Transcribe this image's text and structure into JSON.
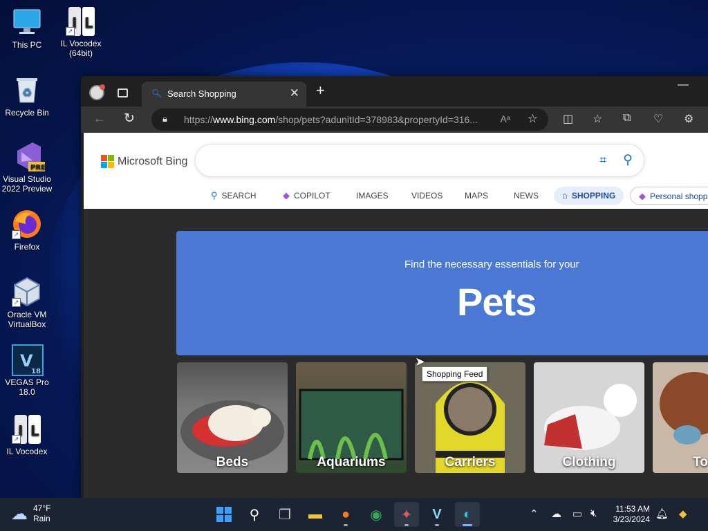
{
  "desktop": {
    "icons": [
      {
        "label": "This PC",
        "icon": "monitor-icon"
      },
      {
        "label": "IL Vocodex (64bit)",
        "icon": "il-vocodex-icon"
      },
      {
        "label": "Recycle Bin",
        "icon": "recycle-bin-icon"
      },
      {
        "label": "Visual Studio 2022 Preview",
        "icon": "visual-studio-icon"
      },
      {
        "label": "Firefox",
        "icon": "firefox-icon"
      },
      {
        "label": "Oracle VM VirtualBox",
        "icon": "virtualbox-icon"
      },
      {
        "label": "VEGAS Pro 18.0",
        "icon": "vegas-icon"
      },
      {
        "label": "IL Vocodex",
        "icon": "il-vocodex-icon"
      }
    ]
  },
  "browser": {
    "tab_title": "Search Shopping",
    "url_prefix": "https://",
    "url_host": "www.bing.com",
    "url_rest": "/shop/pets?adunitId=378983&propertyId=316...",
    "logo_text": "Microsoft Bing",
    "search_placeholder": "",
    "scopes": [
      {
        "label": "SEARCH",
        "icon": "search-icon"
      },
      {
        "label": "COPILOT",
        "icon": "copilot-icon"
      },
      {
        "label": "IMAGES"
      },
      {
        "label": "VIDEOS"
      },
      {
        "label": "MAPS"
      },
      {
        "label": "NEWS"
      },
      {
        "label": "SHOPPING",
        "icon": "shopping-icon",
        "active": true
      },
      {
        "label": "Personal shopp",
        "icon": "copilot-icon"
      }
    ],
    "hero": {
      "subtitle": "Find the necessary essentials for your",
      "title": "Pets"
    },
    "tooltip": "Shopping Feed",
    "categories": [
      {
        "label": "Beds",
        "color": "#6b6b6b"
      },
      {
        "label": "Aquariums",
        "color": "#3d5a3a"
      },
      {
        "label": "Carriers",
        "color": "#c9c12a"
      },
      {
        "label": "Clothing",
        "color": "#d9d9d9"
      },
      {
        "label": "To",
        "color": "#8a5a3a"
      }
    ]
  },
  "taskbar": {
    "weather_temp": "47°F",
    "weather_desc": "Rain",
    "time": "11:53 AM",
    "date": "3/23/2024"
  },
  "colors": {
    "accent": "#1a6ee6",
    "hero_bg": "#4a78d4",
    "taskbar_bg": "#1c2433"
  }
}
